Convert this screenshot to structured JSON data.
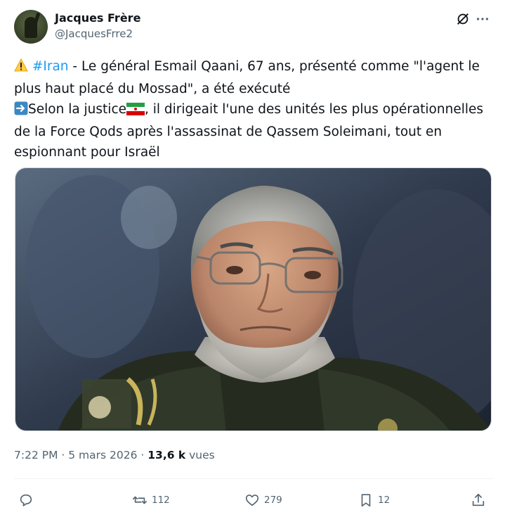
{
  "author": {
    "display_name": "Jacques Frère",
    "handle": "@JacquesFrre2"
  },
  "tweet": {
    "warning_emoji": "⚠️",
    "hashtag": "#Iran",
    "line1_rest": " - Le général Esmail Qaani, 67 ans, présenté comme \"l'agent le",
    "line2": "plus haut placé du Mossad\", a été exécuté",
    "arrow_emoji": "➡️",
    "line3_a": "Selon la justice",
    "line3_b": ", il dirigeait l'une des unités les plus opérationnelles",
    "line4": "de la Force Qods après l'assassinat de Qassem Soleimani, tout en",
    "line5": "espionnant pour Israël"
  },
  "meta": {
    "time": "7:22 PM",
    "separator": " · ",
    "date": "5 mars 2026",
    "views_count": "13,6 k",
    "views_label": " vues"
  },
  "actions": {
    "replies": "",
    "reposts": "112",
    "likes": "279",
    "bookmarks": "12"
  },
  "colors": {
    "accent": "#1d9bf0",
    "text": "#0f1419",
    "muted": "#536471"
  },
  "icons": [
    "grok-icon",
    "more-icon",
    "reply-icon",
    "repost-icon",
    "like-icon",
    "bookmark-icon",
    "share-icon",
    "iran-flag-icon"
  ]
}
